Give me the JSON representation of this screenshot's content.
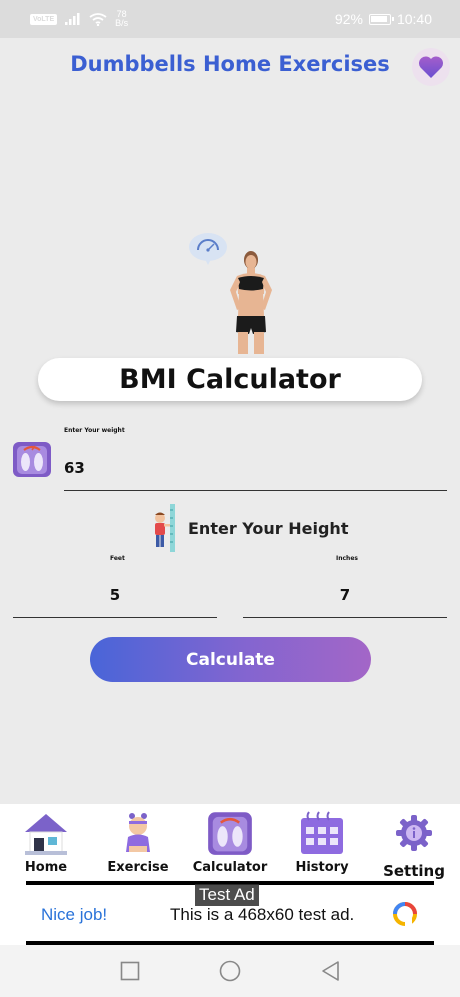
{
  "status_bar": {
    "network_badge": "VoLTE",
    "net_speed_value": "78",
    "net_speed_unit": "B/s",
    "battery_percent": "92%",
    "battery_level": 0.92,
    "time": "10:40"
  },
  "header": {
    "title": "Dumbbells Home Exercises",
    "favorite_icon": "heart-icon"
  },
  "hero": {
    "badge_icon": "speedometer-icon"
  },
  "banner": {
    "title": "BMI Calculator"
  },
  "weight": {
    "label": "Enter Your weight",
    "value": "63",
    "icon": "scale-icon"
  },
  "height": {
    "title": "Enter Your Height",
    "feet_label": "Feet",
    "feet_value": "5",
    "inches_label": "Inches",
    "inches_value": "7"
  },
  "actions": {
    "calculate_label": "Calculate"
  },
  "bottom_nav": {
    "items": [
      {
        "label": "Home",
        "icon": "house-icon"
      },
      {
        "label": "Exercise",
        "icon": "exerciser-icon"
      },
      {
        "label": "Calculator",
        "icon": "scale-icon"
      },
      {
        "label": "History",
        "icon": "calendar-icon"
      },
      {
        "label": "Setting",
        "icon": "gear-icon"
      }
    ]
  },
  "ad": {
    "tag": "Test Ad",
    "left_text": "Nice job!",
    "right_text": "This is a 468x60 test ad."
  },
  "colors": {
    "accent": "#3b5fd2",
    "gradient_start": "#4965d8",
    "gradient_end": "#a366c7",
    "icon_purple": "#7e5bc6"
  }
}
